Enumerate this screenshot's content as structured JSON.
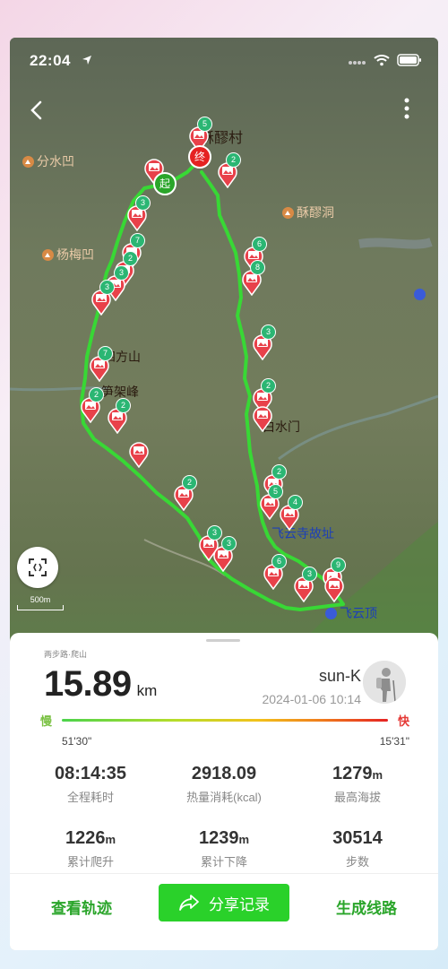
{
  "status_bar": {
    "time": "22:04",
    "icons": [
      "location-arrow-icon",
      "cellular-dots-icon",
      "wifi-icon",
      "battery-icon"
    ]
  },
  "map": {
    "places": {
      "village": "酥醪村",
      "fenshuiao": "分水凹",
      "sulaodong": "酥醪洞",
      "yangmeiao": "杨梅凹",
      "sifangshan": "四方山",
      "dougjiafeng": "笋架峰",
      "baishuimen": "白水门",
      "feiyunsi": "飞云寺故址",
      "feiyunding": "飞云顶"
    },
    "start_label": "起",
    "end_label": "终",
    "scale_label": "500m",
    "colors": {
      "track": "#38d835",
      "marker": "#e8414a",
      "badge": "#2bb673"
    },
    "photo_markers": [
      {
        "badge": "5"
      },
      {
        "badge": "2"
      },
      {
        "badge": ""
      },
      {
        "badge": "3"
      },
      {
        "badge": "7"
      },
      {
        "badge": "2"
      },
      {
        "badge": "3"
      },
      {
        "badge": "3"
      },
      {
        "badge": "7"
      },
      {
        "badge": "2"
      },
      {
        "badge": "2"
      },
      {
        "badge": ""
      },
      {
        "badge": "2"
      },
      {
        "badge": "3"
      },
      {
        "badge": "3"
      },
      {
        "badge": "6"
      },
      {
        "badge": "8"
      },
      {
        "badge": "3"
      },
      {
        "badge": "2"
      },
      {
        "badge": ""
      },
      {
        "badge": "2"
      },
      {
        "badge": "5"
      },
      {
        "badge": "4"
      },
      {
        "badge": "6"
      },
      {
        "badge": "3"
      },
      {
        "badge": "9"
      },
      {
        "badge": ""
      }
    ]
  },
  "summary": {
    "sport_type": "两步路·爬山",
    "distance": "15.89",
    "distance_unit": "km",
    "user": "sun-K",
    "date": "2024-01-06 10:14",
    "speed_slow": "慢",
    "speed_fast": "快",
    "pace_slow": "51'30\"",
    "pace_fast": "15'31\"",
    "stats": [
      {
        "value": "08:14:35",
        "unit": "",
        "label": "全程耗时"
      },
      {
        "value": "2918.09",
        "unit": "",
        "label": "热量消耗(kcal)"
      },
      {
        "value": "1279",
        "unit": "m",
        "label": "最高海拔"
      },
      {
        "value": "1226",
        "unit": "m",
        "label": "累计爬升"
      },
      {
        "value": "1239",
        "unit": "m",
        "label": "累计下降"
      },
      {
        "value": "30514",
        "unit": "",
        "label": "步数"
      }
    ]
  },
  "actions": {
    "view_track": "查看轨迹",
    "share": "分享记录",
    "generate_route": "生成线路"
  }
}
